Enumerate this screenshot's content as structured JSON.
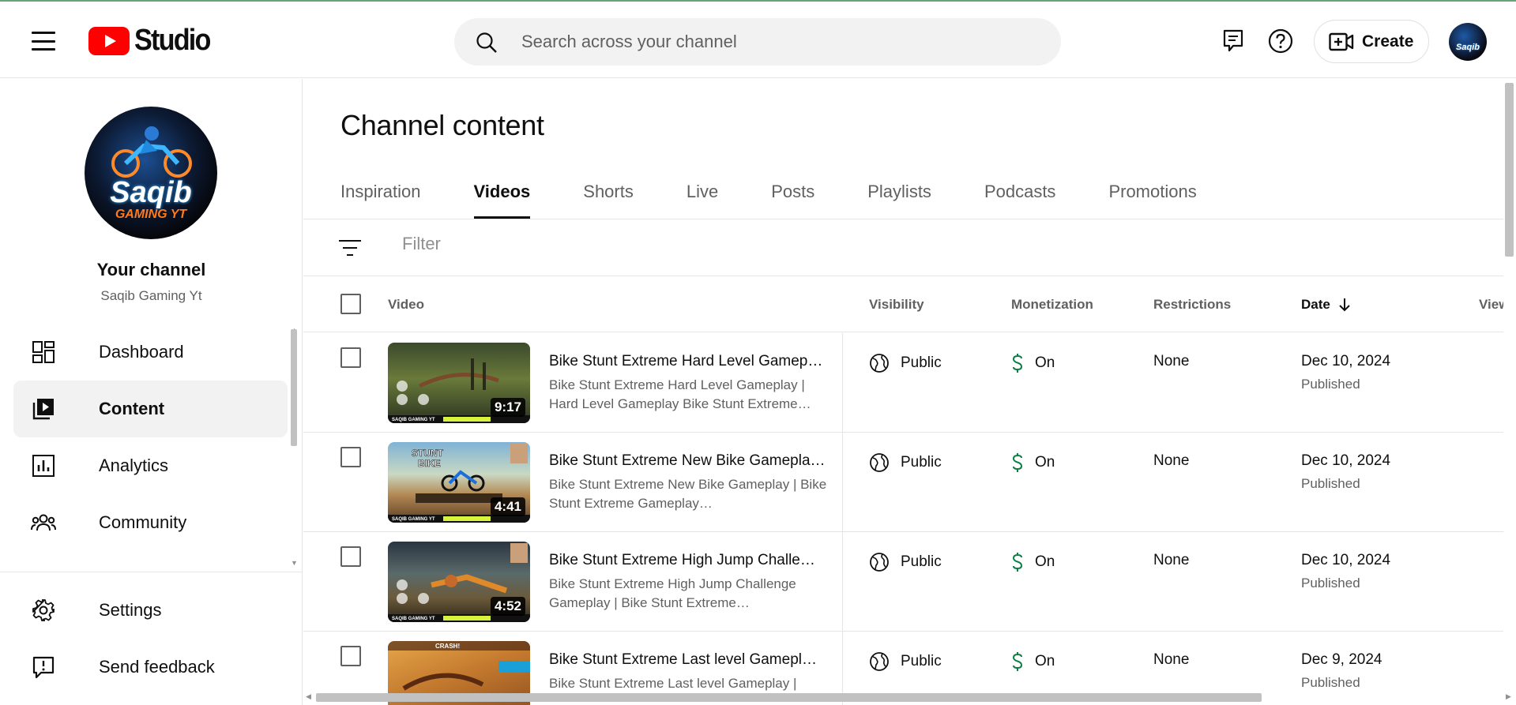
{
  "header": {
    "logo_text": "Studio",
    "search_placeholder": "Search across your channel",
    "create_label": "Create",
    "avatar_text": "Saqib"
  },
  "sidebar": {
    "avatar_line1": "Saqib",
    "avatar_line2": "GAMING YT",
    "channel_title": "Your channel",
    "channel_name": "Saqib Gaming Yt",
    "items": [
      {
        "label": "Dashboard",
        "icon": "dashboard-icon"
      },
      {
        "label": "Content",
        "icon": "content-icon",
        "active": true
      },
      {
        "label": "Analytics",
        "icon": "analytics-icon"
      },
      {
        "label": "Community",
        "icon": "community-icon"
      }
    ],
    "bottom_items": [
      {
        "label": "Settings",
        "icon": "gear-icon"
      },
      {
        "label": "Send feedback",
        "icon": "feedback-icon"
      }
    ]
  },
  "main": {
    "title": "Channel content",
    "tabs": [
      "Inspiration",
      "Videos",
      "Shorts",
      "Live",
      "Posts",
      "Playlists",
      "Podcasts",
      "Promotions"
    ],
    "active_tab": "Videos",
    "filter_placeholder": "Filter",
    "columns": {
      "video": "Video",
      "visibility": "Visibility",
      "monetization": "Monetization",
      "restrictions": "Restrictions",
      "date": "Date",
      "views": "Views"
    },
    "rows": [
      {
        "title": "Bike Stunt Extreme Hard Level Gamep…",
        "description": "Bike Stunt Extreme Hard Level Gameplay | Hard Level Gameplay Bike Stunt Extreme…",
        "duration": "9:17",
        "visibility": "Public",
        "monetization": "On",
        "restrictions": "None",
        "date": "Dec 10, 2024",
        "status": "Published",
        "thumb_caption": "SAQIB GAMING YT"
      },
      {
        "title": "Bike Stunt Extreme New Bike Gamepla…",
        "description": "Bike Stunt Extreme New Bike Gameplay | Bike Stunt Extreme Gameplay…",
        "duration": "4:41",
        "visibility": "Public",
        "monetization": "On",
        "restrictions": "None",
        "date": "Dec 10, 2024",
        "status": "Published",
        "thumb_caption": "SAQIB GAMING YT"
      },
      {
        "title": "Bike Stunt Extreme High Jump Challe…",
        "description": "Bike Stunt Extreme High Jump Challenge Gameplay | Bike Stunt Extreme…",
        "duration": "4:52",
        "visibility": "Public",
        "monetization": "On",
        "restrictions": "None",
        "date": "Dec 10, 2024",
        "status": "Published",
        "thumb_caption": "SAQIB GAMING YT"
      },
      {
        "title": "Bike Stunt Extreme Last level Gamepl…",
        "description": "Bike Stunt Extreme Last level Gameplay |",
        "duration": "",
        "visibility": "Public",
        "monetization": "On",
        "restrictions": "None",
        "date": "Dec 9, 2024",
        "status": "Published",
        "thumb_caption": "CRASH!"
      }
    ]
  },
  "colors": {
    "brand_red": "#ff0000",
    "monetization_green": "#0b8043",
    "text_primary": "#0f0f0f",
    "text_secondary": "#606060"
  }
}
